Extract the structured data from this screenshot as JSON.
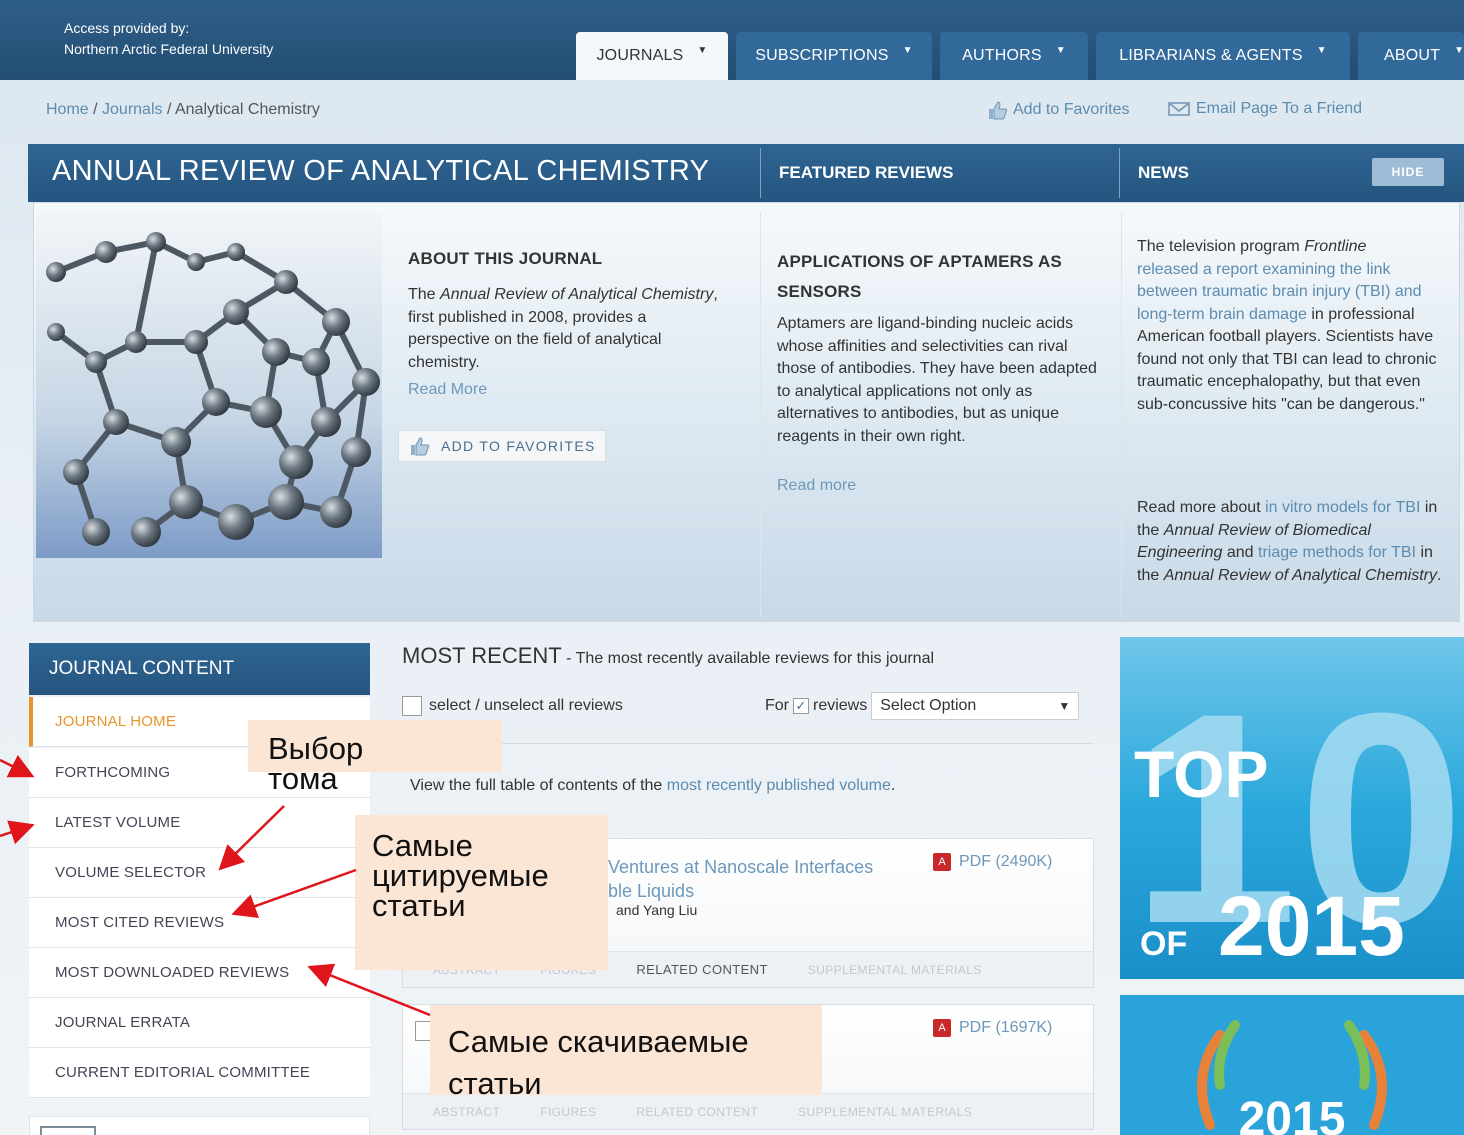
{
  "access": {
    "line1": "Access provided by:",
    "line2": "Northern Arctic Federal University"
  },
  "nav": [
    {
      "label": "JOURNALS"
    },
    {
      "label": "SUBSCRIPTIONS"
    },
    {
      "label": "AUTHORS"
    },
    {
      "label": "LIBRARIANS & AGENTS"
    },
    {
      "label": "ABOUT"
    }
  ],
  "breadcrumb": {
    "home": "Home",
    "sep": " / ",
    "journals": "Journals",
    "current": "Analytical Chemistry"
  },
  "actions": {
    "add_favorites": "Add to Favorites",
    "email_page": "Email Page To a Friend"
  },
  "header": {
    "journal_title": "ANNUAL REVIEW OF ANALYTICAL CHEMISTRY",
    "featured": "FEATURED REVIEWS",
    "news": "NEWS",
    "hide": "HIDE"
  },
  "about": {
    "heading": "ABOUT THIS JOURNAL",
    "text_pre": "The ",
    "text_italic": "Annual Review of Analytical Chemistry",
    "text_post": ", first published in 2008, provides a perspective on the field of analytical chemistry.",
    "read_more": "Read More",
    "add_to_favorites": "ADD TO FAVORITES"
  },
  "featured_review": {
    "heading": "APPLICATIONS OF APTAMERS AS SENSORS",
    "text": "Aptamers are ligand-binding nucleic acids whose affinities and selectivities can rival those of antibodies. They have been adapted to analytical applications not only as alternatives to antibodies, but as unique reagents in their own right.",
    "read_more": "Read more"
  },
  "news": {
    "p1_a": "The television program ",
    "p1_italic": "Frontline",
    "p1_link": "released a report examining the link between traumatic brain injury (TBI) and long-term brain damage",
    "p1_b": " in professional American football players. Scientists have found not only that TBI can lead to chronic traumatic encephalopathy, but that even sub-concussive hits \"can be dangerous.\"",
    "p2_a": "Read more about ",
    "p2_link1": "in vitro models for TBI",
    "p2_b": " in the ",
    "p2_i1": "Annual Review of Biomedical Engineering",
    "p2_c": " and ",
    "p2_link2": "triage methods for TBI",
    "p2_d": " in the ",
    "p2_i2": "Annual Review of Analytical Chemistry",
    "p2_e": "."
  },
  "sidebar": {
    "heading": "JOURNAL CONTENT",
    "items": [
      {
        "label": "JOURNAL HOME"
      },
      {
        "label": "FORTHCOMING"
      },
      {
        "label": "LATEST VOLUME"
      },
      {
        "label": "VOLUME SELECTOR"
      },
      {
        "label": "MOST CITED REVIEWS"
      },
      {
        "label": "MOST DOWNLOADED REVIEWS"
      },
      {
        "label": "JOURNAL ERRATA"
      },
      {
        "label": "CURRENT EDITORIAL COMMITTEE"
      }
    ]
  },
  "main": {
    "title": "MOST RECENT",
    "subtitle": " - The most recently available reviews for this journal",
    "select_all": "select / unselect all reviews",
    "for_label": "For",
    "for_reviews": "reviews",
    "select_option": "Select Option",
    "full_toc_a": "View the full table of contents of the ",
    "full_toc_link": "most recently published volume",
    "full_toc_b": ".",
    "card1": {
      "title1": "Ventures at Nanoscale Interfaces",
      "title2": "ble Liquids",
      "authors": "and Yang Liu",
      "pdf": "PDF (2490K)"
    },
    "card2": {
      "pdf": "PDF (1697K)"
    },
    "card_tabs": [
      "ABSTRACT",
      "FIGURES",
      "RELATED CONTENT",
      "SUPPLEMENTAL MATERIALS"
    ]
  },
  "promo": {
    "top10_top": "TOP",
    "top10_num": "10",
    "top10_of": "OF",
    "top10_year": "2015",
    "award_year": "2015"
  },
  "annotations": {
    "volume": "Выбор тома",
    "cited": "Самые цитируемые статьи",
    "downloaded": "Самые скачиваемые статьи"
  }
}
